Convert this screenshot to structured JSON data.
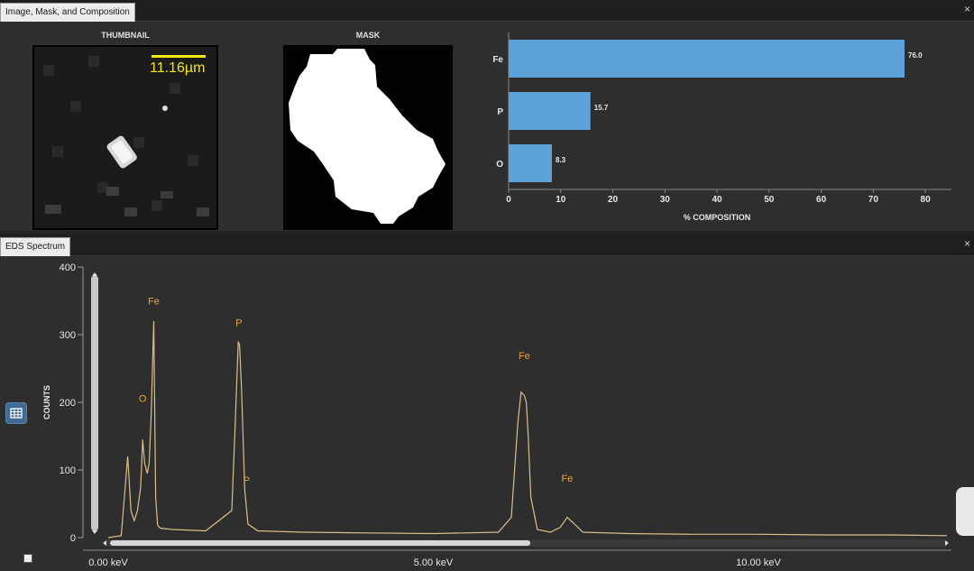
{
  "top_panel": {
    "tab_title": "Image, Mask, and Composition",
    "close_glyph": "×",
    "thumbnail_caption": "THUMBNAIL",
    "scale_label": "11.16µm",
    "mask_caption": "MASK"
  },
  "composition_chart": {
    "chart_data": {
      "type": "bar",
      "orientation": "horizontal",
      "categories": [
        "Fe",
        "P",
        "O"
      ],
      "values": [
        76.0,
        15.7,
        8.3
      ],
      "value_labels": [
        "76.0",
        "15.7",
        "8.3"
      ],
      "xlabel": "% COMPOSITION",
      "xlim": [
        0,
        85
      ],
      "xticks": [
        "0",
        "10",
        "20",
        "30",
        "40",
        "50",
        "60",
        "70",
        "80"
      ],
      "bar_color": "#5ba3d8",
      "grid": false
    }
  },
  "bottom_panel": {
    "tab_title": "EDS Spectrum",
    "close_glyph": "×",
    "ylabel": "COUNTS",
    "yticks": [
      "400",
      "300",
      "200",
      "100",
      "0"
    ],
    "xticks": [
      "0.00 keV",
      "5.00 keV",
      "10.00 keV"
    ],
    "peak_labels": [
      {
        "label": "Fe",
        "kev": 0.7,
        "y": 345
      },
      {
        "label": "O",
        "kev": 0.53,
        "y": 201
      },
      {
        "label": "P",
        "kev": 2.01,
        "y": 313
      },
      {
        "label": "P",
        "kev": 2.13,
        "y": 80
      },
      {
        "label": "Fe",
        "kev": 6.4,
        "y": 264
      },
      {
        "label": "Fe",
        "kev": 7.06,
        "y": 83
      }
    ],
    "chart_data": {
      "type": "line",
      "xlabel": "keV",
      "ylabel": "COUNTS",
      "xlim": [
        0,
        12.9
      ],
      "ylim": [
        0,
        400
      ],
      "series": [
        {
          "x": [
            0.0,
            0.2,
            0.3,
            0.35,
            0.4,
            0.45,
            0.5,
            0.53,
            0.56,
            0.6,
            0.63,
            0.66,
            0.7,
            0.73,
            0.76,
            0.8,
            1.0,
            1.5,
            1.9,
            1.95,
            2.0,
            2.02,
            2.05,
            2.1,
            2.15,
            2.3,
            3.0,
            4.0,
            5.0,
            6.0,
            6.2,
            6.3,
            6.35,
            6.4,
            6.43,
            6.46,
            6.5,
            6.6,
            6.8,
            6.95,
            7.06,
            7.15,
            7.3,
            8.0,
            9.0,
            10.0,
            11.0,
            12.0,
            12.9
          ],
          "y": [
            0,
            3,
            120,
            40,
            25,
            40,
            75,
            145,
            110,
            95,
            110,
            180,
            320,
            60,
            18,
            14,
            12,
            10,
            40,
            160,
            290,
            285,
            220,
            70,
            20,
            10,
            8,
            7,
            6,
            8,
            30,
            170,
            215,
            210,
            200,
            150,
            60,
            12,
            8,
            15,
            30,
            22,
            8,
            6,
            5,
            5,
            4,
            4,
            3
          ]
        }
      ],
      "line_color": "#d9c08a"
    }
  }
}
